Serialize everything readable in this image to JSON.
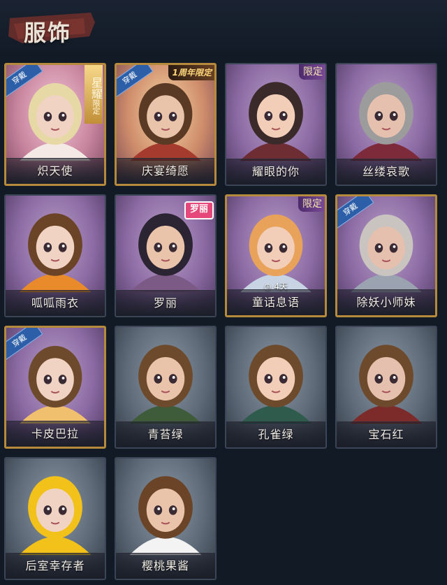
{
  "header": {
    "title": "服饰"
  },
  "outfits": [
    {
      "name": "炽天使",
      "worn_badge": "穿戴",
      "tag_star": [
        "星",
        "耀"
      ],
      "tag_star_small": "限定",
      "frame": "gold",
      "bg": "pink"
    },
    {
      "name": "庆宴绮愿",
      "worn_badge": "穿戴",
      "tag": "1周年限定",
      "frame": "gold",
      "bg": "orange"
    },
    {
      "name": "耀眼的你",
      "tag": "限定",
      "frame": "plain",
      "bg": "purple"
    },
    {
      "name": "丝缕哀歌",
      "frame": "plain",
      "bg": "purple"
    },
    {
      "name": "呱呱雨衣",
      "frame": "plain",
      "bg": "purple"
    },
    {
      "name": "罗丽",
      "tag_pink": "罗丽",
      "frame": "plain",
      "bg": "purple"
    },
    {
      "name": "童话息语",
      "tag": "限定",
      "timer": "4天",
      "frame": "gold",
      "bg": "purple"
    },
    {
      "name": "除妖小师妹",
      "worn_badge": "穿戴",
      "frame": "gold",
      "bg": "purple"
    },
    {
      "name": "卡皮巴拉",
      "worn_badge": "穿戴",
      "frame": "gold",
      "bg": "purple"
    },
    {
      "name": "青苔绿",
      "frame": "plain",
      "bg": "gray"
    },
    {
      "name": "孔雀绿",
      "frame": "plain",
      "bg": "gray"
    },
    {
      "name": "宝石红",
      "frame": "plain",
      "bg": "gray"
    },
    {
      "name": "后室幸存者",
      "frame": "plain",
      "bg": "gray"
    },
    {
      "name": "樱桃果酱",
      "frame": "plain",
      "bg": "gray"
    }
  ],
  "colors": {
    "background": "#121a26",
    "gold_frame": "#b58a3c",
    "worn_badge": "#2c5fa8",
    "limited_tag": "#7c4c98"
  }
}
